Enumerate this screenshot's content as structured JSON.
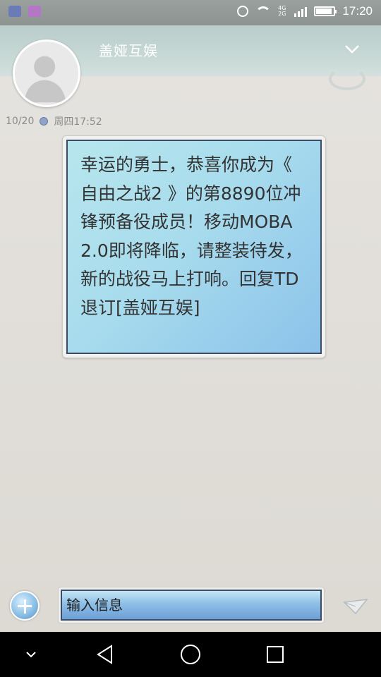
{
  "status_bar": {
    "time": "17:20",
    "network_top": "4G",
    "network_bottom": "2G",
    "battery_level": 0.9,
    "left_icons": [
      "notification-app-icon",
      "gallery-icon"
    ],
    "right_icons": [
      "alarm-icon",
      "wifi-icon",
      "signal-icon",
      "battery-icon"
    ]
  },
  "header": {
    "contact_name": "盖娅互娱",
    "chevron_icon": "chevron-down-icon",
    "avatar_icon": "default-avatar-icon"
  },
  "message": {
    "date": "10/20",
    "time": "周四17:52",
    "sim_icon": "sim-card-icon",
    "body": "幸运的勇士，恭喜你成为《 自由之战2 》的第8890位冲锋预备役成员！移动MOBA2.0即将降临，请整装待发，新的战役马上打响。回复TD退订[盖娅互娱]"
  },
  "composer": {
    "placeholder": "输入信息",
    "add_icon": "add-icon",
    "send_icon": "send-icon"
  },
  "nav_bar": {
    "items": [
      "hide-keyboard-icon",
      "back-icon",
      "home-icon",
      "recents-icon"
    ]
  },
  "colors": {
    "bubble_gradient_start": "#b7e6ed",
    "bubble_gradient_end": "#8cc2ea",
    "header_bg": "#b9cdca",
    "status_bar_bg": "#8d9391"
  }
}
